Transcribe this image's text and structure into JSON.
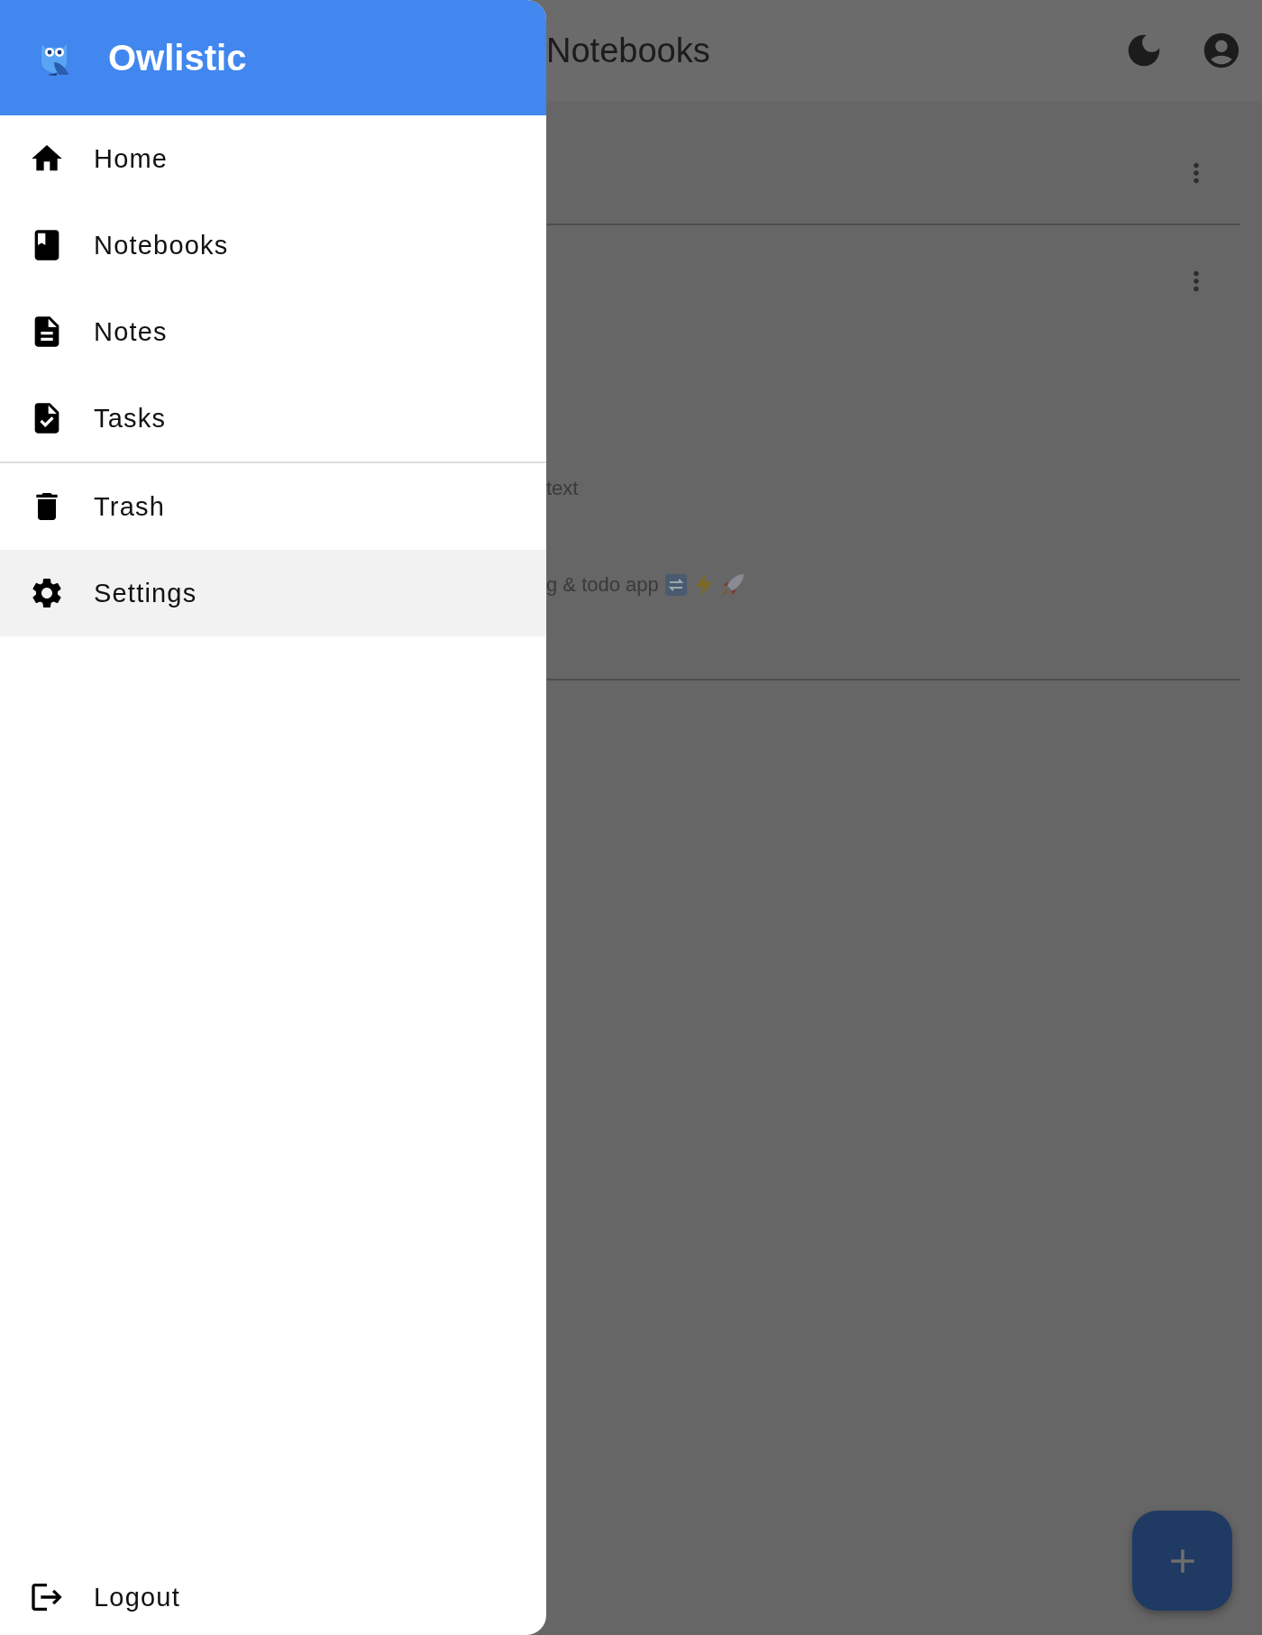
{
  "app_bar": {
    "title": "Notebooks"
  },
  "notebooks": [
    {
      "kind": "notebook"
    },
    {
      "kind": "notebook",
      "lines": [
        {
          "text": "text"
        },
        {
          "text": "g & todo app",
          "emoji": [
            {
              "kind": "refresh"
            },
            {
              "kind": "lightning"
            },
            {
              "kind": "rocket"
            }
          ]
        }
      ]
    }
  ],
  "drawer": {
    "title": "Owlistic",
    "sections": [
      {
        "items": [
          {
            "label": "Home",
            "kind": "home",
            "selected": false
          },
          {
            "label": "Notebooks",
            "kind": "notebooks",
            "selected": false
          },
          {
            "label": "Notes",
            "kind": "notes",
            "selected": false
          },
          {
            "label": "Tasks",
            "kind": "tasks",
            "selected": false
          }
        ]
      },
      {
        "items": [
          {
            "label": "Trash",
            "kind": "trash",
            "selected": false
          },
          {
            "label": "Settings",
            "kind": "settings",
            "selected": true
          }
        ]
      }
    ],
    "footer": {
      "label": "Logout",
      "kind": "logout"
    }
  }
}
